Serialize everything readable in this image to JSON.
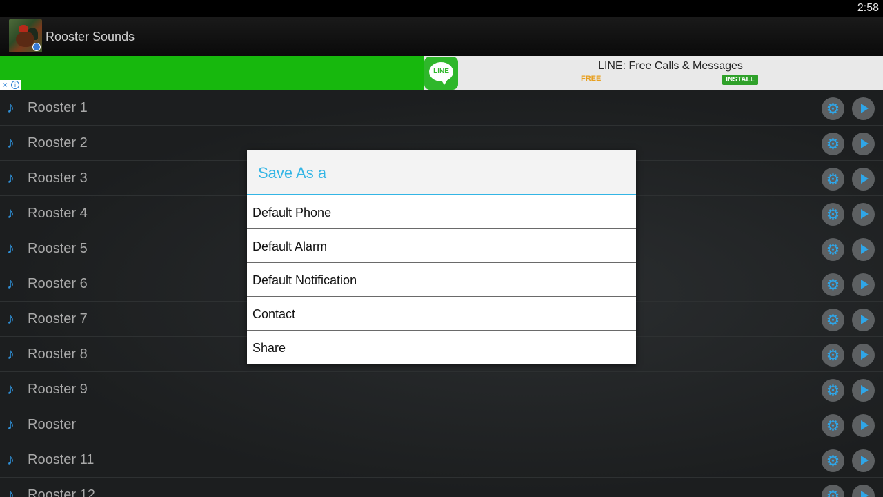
{
  "status_bar": {
    "time": "2:58"
  },
  "action_bar": {
    "title": "Rooster Sounds"
  },
  "ad": {
    "title": "LINE: Free Calls & Messages",
    "price": "FREE",
    "install_label": "INSTALL",
    "logo_text": "LINE",
    "close_glyph": "×",
    "info_glyph": "i"
  },
  "list": {
    "items": [
      {
        "label": "Rooster 1"
      },
      {
        "label": "Rooster 2"
      },
      {
        "label": "Rooster 3"
      },
      {
        "label": "Rooster 4"
      },
      {
        "label": "Rooster 5"
      },
      {
        "label": "Rooster 6"
      },
      {
        "label": "Rooster 7"
      },
      {
        "label": "Rooster 8"
      },
      {
        "label": "Rooster 9"
      },
      {
        "label": "Rooster"
      },
      {
        "label": "Rooster 11"
      },
      {
        "label": "Rooster 12"
      }
    ],
    "note_icon": "♪",
    "gear_icon": "⚙"
  },
  "dialog": {
    "title": "Save As a",
    "options": [
      {
        "label": "Default Phone"
      },
      {
        "label": "Default Alarm"
      },
      {
        "label": "Default Notification"
      },
      {
        "label": "Contact"
      },
      {
        "label": "Share"
      }
    ]
  },
  "colors": {
    "accent": "#33b5e5",
    "note_icon": "#2f8fd6",
    "ad_green": "#17b80d",
    "install_green": "#2fa12a"
  }
}
